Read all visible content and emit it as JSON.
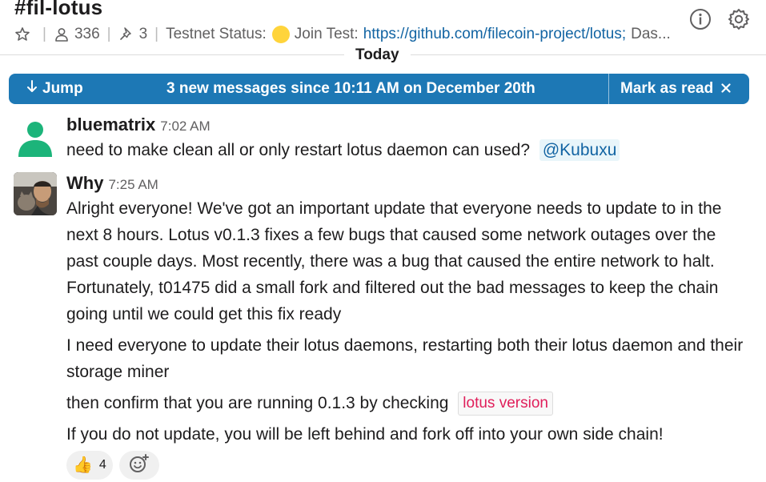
{
  "header": {
    "channel_title": "#fil-lotus",
    "member_count": "336",
    "pinned_count": "3",
    "topic_label": "Testnet Status:",
    "topic_join": "Join Test:",
    "topic_link": "https://github.com/filecoin-project/lotus;",
    "topic_tail": "Das...",
    "star_icon": "star-icon",
    "members_icon": "person-icon",
    "pin_icon": "pin-icon",
    "info_icon": "info-icon",
    "settings_icon": "gear-icon"
  },
  "divider": {
    "label": "Today"
  },
  "banner": {
    "jump_label": "Jump",
    "text": "3 new messages since 10:11 AM on December 20th",
    "mark_read_label": "Mark as read",
    "color": "#1d78b5"
  },
  "messages": [
    {
      "author": "bluematrix",
      "time": "7:02 AM",
      "text": "need to make clean all or only restart lotus daemon can used?",
      "mention": "@Kubuxu"
    },
    {
      "author": "Why",
      "time": "7:25 AM",
      "paragraphs": [
        "Alright everyone! We've got an important update that everyone needs to update to in the next 8 hours. Lotus v0.1.3 fixes a few bugs that caused some network outages over the past couple days. Most recently, there was a bug that caused the entire network to halt. Fortunately, t01475 did a small fork and filtered out the bad messages to keep the chain going until we could get this fix ready",
        "I need everyone to update their lotus daemons, restarting both their lotus daemon and their storage miner",
        "then confirm that you are running 0.1.3 by checking",
        "If you do not update, you will be left behind and fork off into your own side chain!"
      ],
      "code": "lotus version",
      "reactions": [
        {
          "emoji": "👍",
          "count": "4"
        }
      ]
    }
  ]
}
